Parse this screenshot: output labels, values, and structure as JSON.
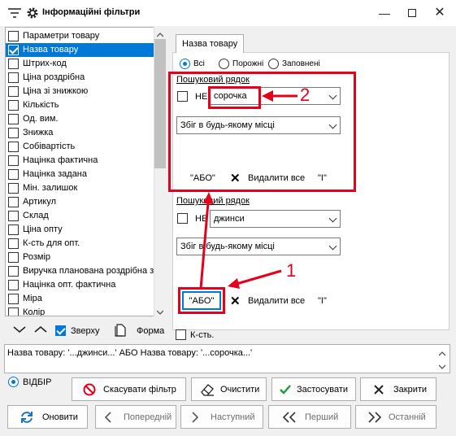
{
  "window": {
    "title": "Інформаційні фільтри"
  },
  "fields": [
    {
      "label": "Параметри товару",
      "checked": false,
      "selected": false
    },
    {
      "label": "Назва товару",
      "checked": true,
      "selected": true
    },
    {
      "label": "Штрих-код",
      "checked": false,
      "selected": false
    },
    {
      "label": "Ціна роздрібна",
      "checked": false,
      "selected": false
    },
    {
      "label": "Ціна зі знижкою",
      "checked": false,
      "selected": false
    },
    {
      "label": "Кількість",
      "checked": false,
      "selected": false
    },
    {
      "label": "Од. вим.",
      "checked": false,
      "selected": false
    },
    {
      "label": "Знижка",
      "checked": false,
      "selected": false
    },
    {
      "label": "Собівартість",
      "checked": false,
      "selected": false
    },
    {
      "label": "Націнка фактична",
      "checked": false,
      "selected": false
    },
    {
      "label": "Націнка задана",
      "checked": false,
      "selected": false
    },
    {
      "label": "Мін. залишок",
      "checked": false,
      "selected": false
    },
    {
      "label": "Артикул",
      "checked": false,
      "selected": false
    },
    {
      "label": "Склад",
      "checked": false,
      "selected": false
    },
    {
      "label": "Ціна опту",
      "checked": false,
      "selected": false
    },
    {
      "label": "К-сть для опт.",
      "checked": false,
      "selected": false
    },
    {
      "label": "Розмір",
      "checked": false,
      "selected": false
    },
    {
      "label": "Виручка планована роздрібна з",
      "checked": false,
      "selected": false
    },
    {
      "label": "Націнка опт. фактична",
      "checked": false,
      "selected": false
    },
    {
      "label": "Міра",
      "checked": false,
      "selected": false
    },
    {
      "label": "Колір",
      "checked": false,
      "selected": false
    }
  ],
  "list_toolbar": {
    "top_label": "Зверху",
    "form_label": "Форма"
  },
  "filter": {
    "tab": "Назва товару",
    "radios": [
      "Всі",
      "Порожні",
      "Заповнені"
    ],
    "block1": {
      "label": "Пошуковий рядок",
      "not": "НЕ",
      "value": "сорочка",
      "mode": "Збіг в будь-якому місці",
      "or": "\"АБО\"",
      "delete": "Видалити все",
      "and": "\"І\""
    },
    "block2": {
      "label": "Пошуковий рядок",
      "not": "НЕ",
      "value": "джинси",
      "mode": "Збіг в будь-якому місці",
      "or": "\"АБО\"",
      "delete": "Видалити все",
      "and": "\"І\""
    },
    "annotation1": "1",
    "annotation2": "2"
  },
  "count_label": "К-сть.",
  "expression": "Назва товару:  '...джинси...' АБО Назва товару:  '...сорочка...'",
  "mode_label": "ВІДБІР",
  "buttons": {
    "cancel_filter": "Скасувати фільтр",
    "clear": "Очистити",
    "apply": "Застосувати",
    "close": "Закрити",
    "refresh": "Оновити",
    "prev": "Попередній",
    "next": "Наступний",
    "first": "Перший",
    "last": "Останній"
  }
}
